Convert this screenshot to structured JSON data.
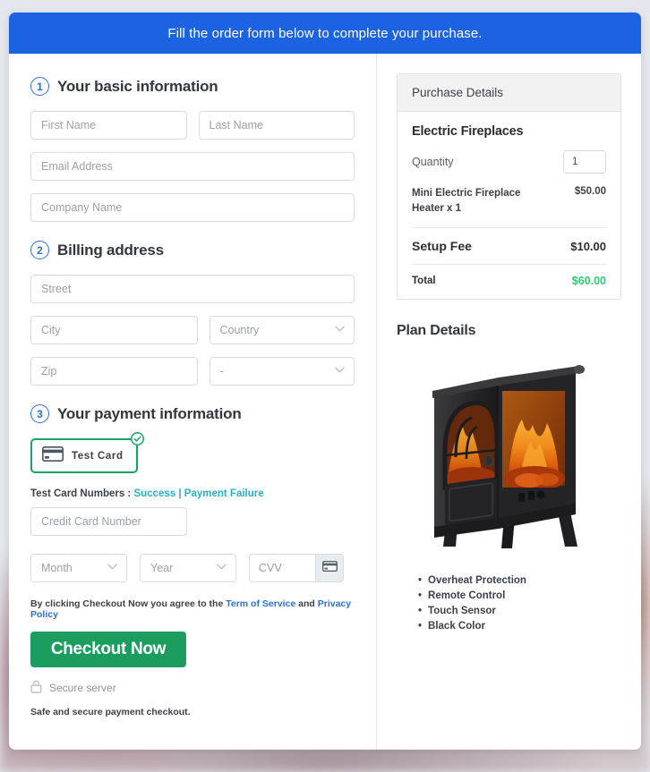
{
  "banner": {
    "text": "Fill the order form below to complete your purchase."
  },
  "steps": [
    {
      "num": "1",
      "title": "Your basic information"
    },
    {
      "num": "2",
      "title": "Billing address"
    },
    {
      "num": "3",
      "title": "Your payment information"
    }
  ],
  "basic_info": {
    "first_name_placeholder": "First Name",
    "last_name_placeholder": "Last Name",
    "email_placeholder": "Email Address",
    "company_placeholder": "Company Name"
  },
  "billing": {
    "street_placeholder": "Street",
    "city_placeholder": "City",
    "country_placeholder": "Country",
    "zip_placeholder": "Zip",
    "state_placeholder": "-"
  },
  "payment": {
    "method_label": "Test Card",
    "test_numbers_label": "Test Card Numbers :",
    "success_link": "Success",
    "separator": "|",
    "failure_link": "Payment Failure",
    "card_number_placeholder": "Credit Card Number",
    "month_placeholder": "Month",
    "year_placeholder": "Year",
    "cvv_placeholder": "CVV"
  },
  "terms": {
    "prefix": "By clicking Checkout Now you agree to the",
    "tos_link": "Term of Service",
    "conjunction": "and",
    "privacy_link": "Privacy Policy"
  },
  "checkout": {
    "button_label": "Checkout Now",
    "secure_label": "Secure server",
    "safe_note": "Safe and secure payment checkout."
  },
  "purchase": {
    "header": "Purchase Details",
    "product_name": "Electric Fireplaces",
    "quantity_label": "Quantity",
    "quantity_value": "1",
    "line_item_desc": "Mini Electric Fireplace Heater x 1",
    "line_item_amount": "$50.00",
    "setup_fee_label": "Setup Fee",
    "setup_fee_amount": "$10.00",
    "total_label": "Total",
    "total_amount": "$60.00"
  },
  "plan": {
    "title": "Plan Details",
    "features": [
      "Overheat Protection",
      "Remote Control",
      "Touch Sensor",
      "Black Color"
    ]
  },
  "colors": {
    "banner_blue": "#1b63e3",
    "step_blue": "#2a6fdb",
    "checkout_green": "#1a9d5e",
    "total_green": "#2ecb71",
    "link_teal": "#27b0c4",
    "selected_border": "#17a463"
  }
}
